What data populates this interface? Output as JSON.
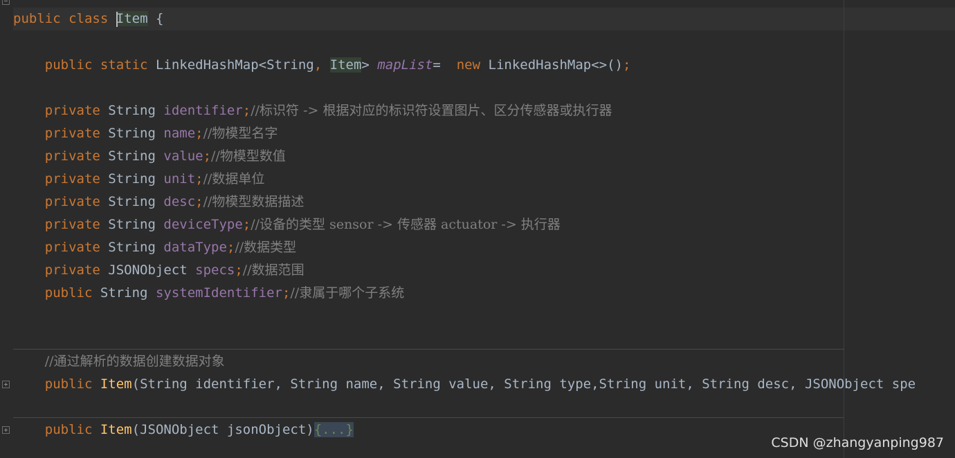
{
  "code": {
    "class_decl": {
      "kw1": "public",
      "kw2": "class",
      "name": "Item",
      "brace": "{"
    },
    "map_decl": {
      "kw1": "public",
      "kw2": "static",
      "type_a": "LinkedHashMap<String",
      "comma": ",",
      "type_b": "Item",
      "gt": ">",
      "name": "mapList",
      "eq": "=",
      "kw_new": "new",
      "ctor": "LinkedHashMap<>()",
      "semi": ";"
    },
    "fields": [
      {
        "mod": "private",
        "type": "String",
        "name": "identifier",
        "comment": "//标识符 -> 根据对应的标识符设置图片、区分传感器或执行器"
      },
      {
        "mod": "private",
        "type": "String",
        "name": "name",
        "comment": "//物模型名字"
      },
      {
        "mod": "private",
        "type": "String",
        "name": "value",
        "comment": "//物模型数值"
      },
      {
        "mod": "private",
        "type": "String",
        "name": "unit",
        "comment": "//数据单位"
      },
      {
        "mod": "private",
        "type": "String",
        "name": "desc",
        "comment": "//物模型数据描述"
      },
      {
        "mod": "private",
        "type": "String",
        "name": "deviceType",
        "comment": "//设备的类型 sensor -> 传感器 actuator -> 执行器"
      },
      {
        "mod": "private",
        "type": "String",
        "name": "dataType",
        "comment": "//数据类型"
      },
      {
        "mod": "private",
        "type": "JSONObject",
        "name": "specs",
        "comment": "//数据范围"
      },
      {
        "mod": "public",
        "type": "String",
        "name": "systemIdentifier",
        "comment": "//隶属于哪个子系统"
      }
    ],
    "ctor_comment": "//通过解析的数据创建数据对象",
    "ctor1": {
      "kw": "public",
      "name": "Item",
      "open": "(",
      "params": "String identifier, String name, String value, String type,String unit, String desc, JSONObject spe"
    },
    "ctor2": {
      "kw": "public",
      "name": "Item",
      "params": "(JSONObject jsonObject)",
      "folded": "{...}"
    }
  },
  "watermark": "CSDN @zhangyanping987",
  "colors": {
    "background": "#2b2b2b",
    "keyword": "#cc7832",
    "field": "#9876aa",
    "comment": "#808080",
    "method": "#ffc66d",
    "text": "#a9b7c6"
  }
}
